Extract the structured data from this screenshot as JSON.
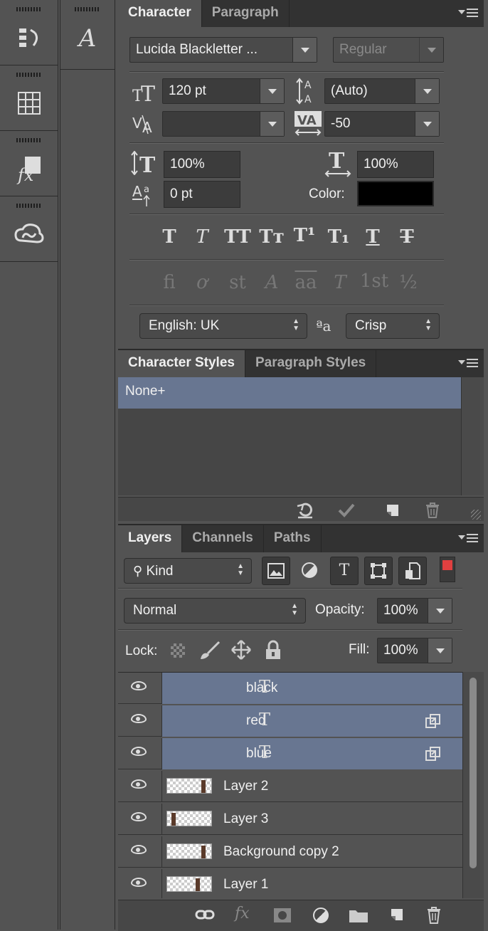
{
  "character_panel": {
    "tabs": [
      "Character",
      "Paragraph"
    ],
    "font_family": "Lucida Blackletter ...",
    "font_style": "Regular",
    "font_size": "120 pt",
    "leading": "(Auto)",
    "kerning": "",
    "tracking": "-50",
    "vertical_scale": "100%",
    "horizontal_scale": "100%",
    "baseline_shift": "0 pt",
    "color_label": "Color:",
    "color_value": "#000000",
    "style_buttons": [
      "T",
      "T",
      "TT",
      "Tт",
      "T¹",
      "T₁",
      "T",
      "T"
    ],
    "opentype_buttons": [
      "fi",
      "ơ",
      "st",
      "A",
      "aa",
      "T",
      "1st",
      "½"
    ],
    "language": "English: UK",
    "aa_icon": "ªa",
    "antialias": "Crisp"
  },
  "styles_panel": {
    "tabs": [
      "Character Styles",
      "Paragraph Styles"
    ],
    "items": [
      "None+"
    ]
  },
  "layers_panel": {
    "tabs": [
      "Layers",
      "Channels",
      "Paths"
    ],
    "filter": "Kind",
    "blend_mode": "Normal",
    "opacity_label": "Opacity:",
    "opacity": "100%",
    "lock_label": "Lock:",
    "fill_label": "Fill:",
    "fill": "100%",
    "layers": [
      {
        "name": "black",
        "type": "text",
        "selected": true
      },
      {
        "name": "red",
        "type": "text",
        "selected": true
      },
      {
        "name": "blue",
        "type": "text",
        "selected": true
      },
      {
        "name": "Layer 2",
        "type": "pixel",
        "selected": false
      },
      {
        "name": "Layer 3",
        "type": "pixel",
        "selected": false
      },
      {
        "name": "Background copy 2",
        "type": "pixel",
        "selected": false
      },
      {
        "name": "Layer 1",
        "type": "pixel",
        "selected": false
      }
    ]
  },
  "colors": {
    "selection": "#687691",
    "panel": "#535353",
    "tab_bar": "#323232",
    "swatch_red": "#e04040"
  }
}
